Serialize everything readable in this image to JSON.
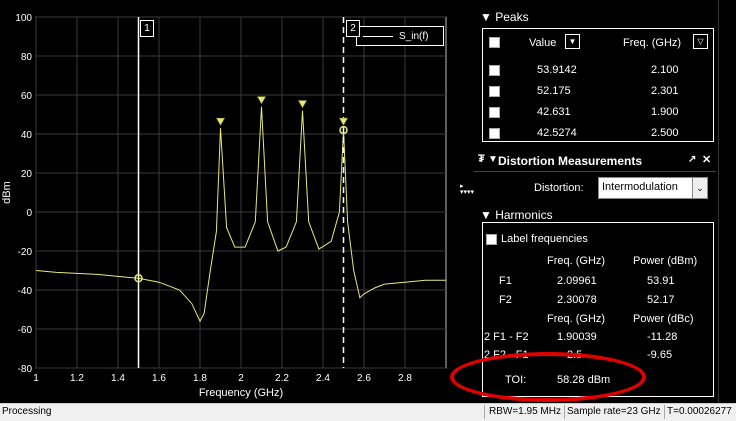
{
  "chart_data": {
    "type": "line",
    "xlabel": "Frequency (GHz)",
    "ylabel": "dBm",
    "xlim": [
      1,
      3
    ],
    "ylim": [
      -80,
      100
    ],
    "xticks": [
      "1",
      "1.2",
      "1.4",
      "1.6",
      "1.8",
      "2",
      "2.2",
      "2.4",
      "2.6",
      "2.8"
    ],
    "yticks": [
      "100",
      "80",
      "60",
      "40",
      "20",
      "0",
      "-20",
      "-40",
      "-60",
      "-80"
    ],
    "grid": true,
    "series": [
      {
        "name": "S_in(f)",
        "color": "#e8e87a",
        "points": [
          [
            1.0,
            -30
          ],
          [
            1.1,
            -31
          ],
          [
            1.2,
            -31.5
          ],
          [
            1.3,
            -32
          ],
          [
            1.4,
            -33
          ],
          [
            1.5,
            -34
          ],
          [
            1.6,
            -36
          ],
          [
            1.7,
            -40
          ],
          [
            1.76,
            -47
          ],
          [
            1.8,
            -56
          ],
          [
            1.82,
            -52
          ],
          [
            1.85,
            -30
          ],
          [
            1.88,
            -10
          ],
          [
            1.9,
            43
          ],
          [
            1.93,
            -8
          ],
          [
            1.97,
            -18
          ],
          [
            2.02,
            -18
          ],
          [
            2.07,
            -5
          ],
          [
            2.1,
            54
          ],
          [
            2.13,
            -5
          ],
          [
            2.18,
            -20
          ],
          [
            2.22,
            -18
          ],
          [
            2.27,
            -5
          ],
          [
            2.3,
            52
          ],
          [
            2.33,
            -5
          ],
          [
            2.38,
            -19
          ],
          [
            2.44,
            -15
          ],
          [
            2.48,
            0
          ],
          [
            2.5,
            42
          ],
          [
            2.52,
            -5
          ],
          [
            2.55,
            -30
          ],
          [
            2.58,
            -44
          ],
          [
            2.6,
            -42
          ],
          [
            2.65,
            -39
          ],
          [
            2.7,
            -37
          ],
          [
            2.8,
            -36
          ],
          [
            2.9,
            -35
          ],
          [
            3.0,
            -35
          ]
        ]
      }
    ],
    "peak_markers": [
      {
        "x": 1.9,
        "y": 43
      },
      {
        "x": 2.1,
        "y": 54
      },
      {
        "x": 2.3,
        "y": 52
      },
      {
        "x": 2.5,
        "y": 43
      }
    ],
    "cursors": [
      {
        "label": "1",
        "x": 1.5,
        "y": -34,
        "style": "solid"
      },
      {
        "label": "2",
        "x": 2.5,
        "y": 42,
        "style": "dashed"
      }
    ],
    "legend_position": "top-right"
  },
  "peaks": {
    "title": "Peaks",
    "col_value": "Value",
    "col_freq": "Freq. (GHz)",
    "rows": [
      {
        "value": "53.9142",
        "freq": "2.100"
      },
      {
        "value": "52.175",
        "freq": "2.301"
      },
      {
        "value": "42.631",
        "freq": "1.900"
      },
      {
        "value": "42.5274",
        "freq": "2.500"
      }
    ]
  },
  "distortion": {
    "title": "Distortion Measurements",
    "label": "Distortion:",
    "selected": "Intermodulation"
  },
  "harmonics": {
    "title": "Harmonics",
    "label_freq": "Label frequencies",
    "col_freq": "Freq. (GHz)",
    "col_power_dbm": "Power (dBm)",
    "col_power_dbc": "Power (dBc)",
    "tones": [
      {
        "name": "F1",
        "freq": "2.09961",
        "power": "53.91"
      },
      {
        "name": "F2",
        "freq": "2.30078",
        "power": "52.17"
      }
    ],
    "products": [
      {
        "name": "2 F1 - F2",
        "freq": "1.90039",
        "power": "-11.28"
      },
      {
        "name": "2 F2 - F1",
        "freq": "2.5",
        "power": "-9.65"
      }
    ],
    "toi_label": "TOI:",
    "toi_value": "58.28 dBm"
  },
  "status": {
    "left": "Processing",
    "rbw": "RBW=1.95 MHz",
    "sample_rate": "Sample rate=23 GHz",
    "time": "T=0.00026277"
  }
}
